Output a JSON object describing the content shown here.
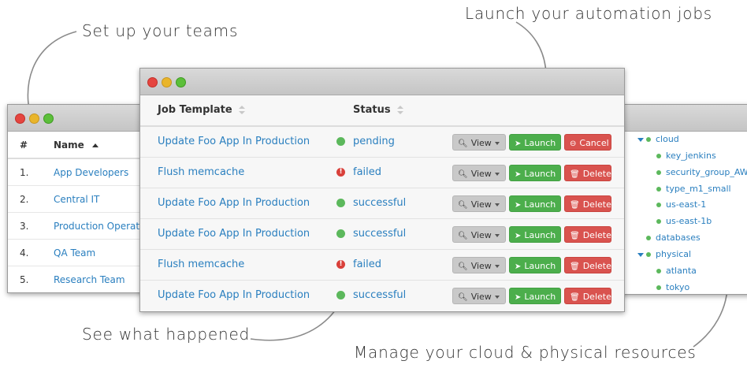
{
  "callouts": {
    "teams": "Set up your teams",
    "launch": "Launch your automation jobs",
    "happened": "See what happened",
    "manage": "Manage your cloud & physical resources"
  },
  "teams_window": {
    "col_num": "#",
    "col_name": "Name",
    "rows": [
      {
        "num": "1.",
        "name": "App Developers"
      },
      {
        "num": "2.",
        "name": "Central IT"
      },
      {
        "num": "3.",
        "name": "Production Operations"
      },
      {
        "num": "4.",
        "name": "QA Team"
      },
      {
        "num": "5.",
        "name": "Research Team"
      }
    ]
  },
  "jobs_window": {
    "col_template": "Job Template",
    "col_status": "Status",
    "view_label": "View",
    "launch_label": "Launch",
    "cancel_label": "Cancel",
    "delete_label": "Delete",
    "rows": [
      {
        "name": "Update Foo App In Production",
        "status": "pending",
        "state": "ok",
        "action": "Cancel"
      },
      {
        "name": "Flush memcache",
        "status": "failed",
        "state": "fail",
        "action": "Delete"
      },
      {
        "name": "Update Foo App In Production",
        "status": "successful",
        "state": "ok",
        "action": "Delete"
      },
      {
        "name": "Update Foo App In Production",
        "status": "successful",
        "state": "ok",
        "action": "Delete"
      },
      {
        "name": "Flush memcache",
        "status": "failed",
        "state": "fail",
        "action": "Delete"
      },
      {
        "name": "Update Foo App In Production",
        "status": "successful",
        "state": "ok",
        "action": "Delete"
      }
    ]
  },
  "inventory_window": {
    "nodes": [
      {
        "label": "cloud",
        "level": 0,
        "expanded": true
      },
      {
        "label": "key_jenkins",
        "level": 1
      },
      {
        "label": "security_group_AWX",
        "level": 1
      },
      {
        "label": "type_m1_small",
        "level": 1
      },
      {
        "label": "us-east-1",
        "level": 1
      },
      {
        "label": "us-east-1b",
        "level": 1
      },
      {
        "label": "databases",
        "level": 0
      },
      {
        "label": "physical",
        "level": 0,
        "expanded": true
      },
      {
        "label": "atlanta",
        "level": 1
      },
      {
        "label": "tokyo",
        "level": 1
      }
    ]
  },
  "colors": {
    "link": "#2a7fbf",
    "success": "#5cb85c",
    "danger": "#d9534f",
    "launch": "#4cae4c"
  }
}
